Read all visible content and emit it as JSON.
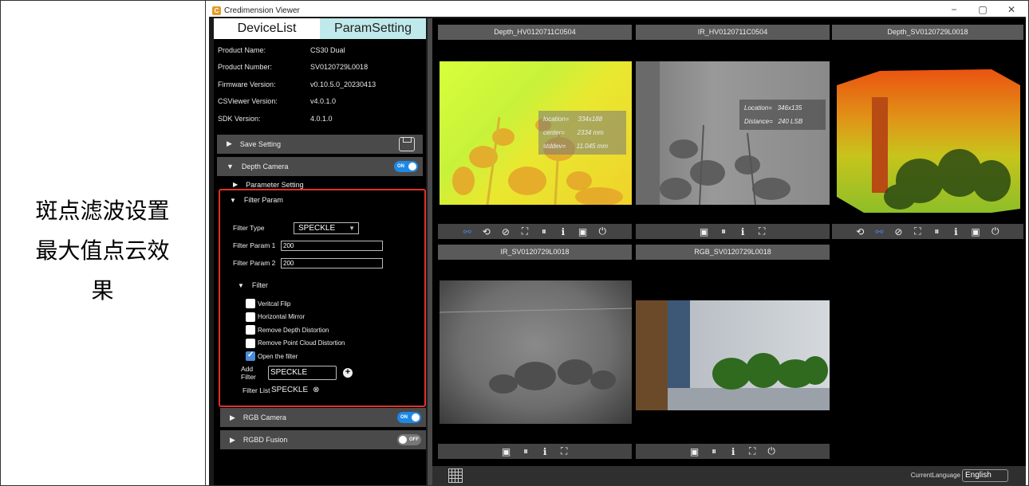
{
  "caption": {
    "line1": "斑点滤波设置",
    "line2": "最大值点云效",
    "line3": "果"
  },
  "window": {
    "title": "Credimension Viewer",
    "controls": [
      "−",
      "▢",
      "✕"
    ]
  },
  "tabs": [
    {
      "label": "DeviceList",
      "active": false
    },
    {
      "label": "ParamSetting",
      "active": true
    }
  ],
  "info": [
    {
      "key": "Product Name:",
      "value": "CS30 Dual"
    },
    {
      "key": "Product Number:",
      "value": "SV0120729L0018"
    },
    {
      "key": "Firmware Version:",
      "value": "v0.10.5.0_20230413"
    },
    {
      "key": "CSViewer Version:",
      "value": "v4.0.1.0"
    },
    {
      "key": "SDK Version:",
      "value": "4.0.1.0"
    }
  ],
  "sections": {
    "save_setting": "Save Setting",
    "depth_camera": "Depth Camera",
    "parameter_setting": "Parameter Setting",
    "filter_param": "Filter Param",
    "filter": "Filter",
    "rgb_camera": "RGB Camera",
    "rgbd_fusion": "RGBD Fusion"
  },
  "toggles": {
    "on_label": "ON",
    "off_label": "OFF",
    "depth_camera": true,
    "rgb_camera": true,
    "rgbd_fusion": false
  },
  "filter_param": {
    "type_label": "Filter Type",
    "type_value": "SPECKLE",
    "param1_label": "Filter Param 1",
    "param1_value": "200",
    "param2_label": "Filter Param 2",
    "param2_value": "200"
  },
  "filter": {
    "checkboxes": [
      {
        "label": "Veritcal Flip",
        "checked": false
      },
      {
        "label": "Horizontal Mirror",
        "checked": false
      },
      {
        "label": "Remove Depth Distortion",
        "checked": false
      },
      {
        "label": "Remove Point Cloud Distortion",
        "checked": false
      },
      {
        "label": "Open the filter",
        "checked": true
      }
    ],
    "add_filter_label": "Add Filter",
    "add_filter_value": "SPECKLE",
    "filter_list_label": "Filter List",
    "filter_list_item": "SPECKLE"
  },
  "views": {
    "v1": "Depth_HV0120711C0504",
    "v2": "IR_HV0120711C0504",
    "v3": "Depth_SV0120729L0018",
    "v4": "IR_SV0120729L0018",
    "v5": "RGB_SV0120729L0018"
  },
  "readouts": {
    "depth": {
      "location_label": "location=",
      "location_value": "334x188",
      "center_label": "center=",
      "center_value": "2334 mm",
      "stddev_label": "stddev=",
      "stddev_value": "11.045 mm"
    },
    "ir": {
      "location_label": "Location=",
      "location_value": "346x135",
      "distance_label": "Distance=",
      "distance_value": "240 LSB"
    }
  },
  "status": {
    "language_label": "CurrentLanguage",
    "language_value": "English"
  },
  "colors": {
    "accent": "#1e88e5",
    "highlight_border": "#e0312b",
    "active_tab": "#bfe9ea"
  }
}
